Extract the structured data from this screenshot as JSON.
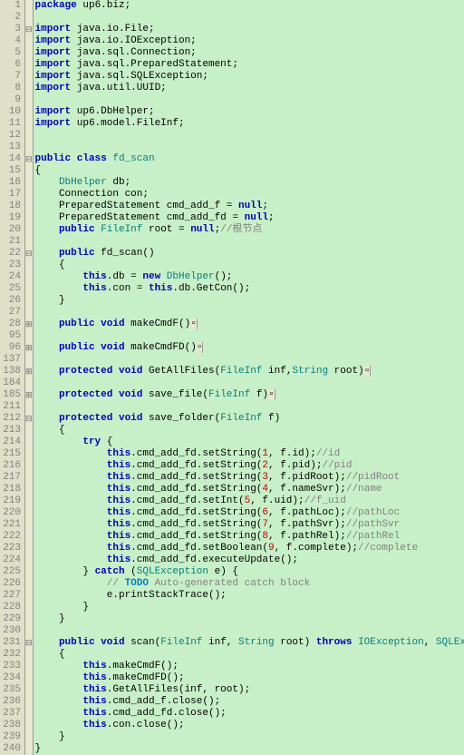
{
  "lines": [
    {
      "n": "1",
      "f": "",
      "t": [
        [
          "kw",
          "package"
        ],
        [
          "pk",
          " up6.biz;"
        ]
      ]
    },
    {
      "n": "2",
      "f": "",
      "t": []
    },
    {
      "n": "3",
      "f": "-",
      "t": [
        [
          "kw",
          "import"
        ],
        [
          "pk",
          " java.io.File;"
        ]
      ]
    },
    {
      "n": "4",
      "f": "",
      "t": [
        [
          "kw",
          "import"
        ],
        [
          "pk",
          " java.io.IOException;"
        ]
      ]
    },
    {
      "n": "5",
      "f": "",
      "t": [
        [
          "kw",
          "import"
        ],
        [
          "pk",
          " java.sql.Connection;"
        ]
      ]
    },
    {
      "n": "6",
      "f": "",
      "t": [
        [
          "kw",
          "import"
        ],
        [
          "pk",
          " java.sql.PreparedStatement;"
        ]
      ]
    },
    {
      "n": "7",
      "f": "",
      "t": [
        [
          "kw",
          "import"
        ],
        [
          "pk",
          " java.sql.SQLException;"
        ]
      ]
    },
    {
      "n": "8",
      "f": "",
      "t": [
        [
          "kw",
          "import"
        ],
        [
          "pk",
          " java.util.UUID;"
        ]
      ]
    },
    {
      "n": "9",
      "f": "",
      "t": []
    },
    {
      "n": "10",
      "f": "",
      "t": [
        [
          "kw",
          "import"
        ],
        [
          "pk",
          " up6.DbHelper;"
        ]
      ]
    },
    {
      "n": "11",
      "f": "",
      "t": [
        [
          "kw",
          "import"
        ],
        [
          "pk",
          " up6.model.FileInf;"
        ]
      ]
    },
    {
      "n": "12",
      "f": "",
      "t": []
    },
    {
      "n": "13",
      "f": "",
      "t": []
    },
    {
      "n": "14",
      "f": "-",
      "t": [
        [
          "kw",
          "public class "
        ],
        [
          "tp",
          "fd_scan"
        ]
      ]
    },
    {
      "n": "15",
      "f": "",
      "t": [
        [
          "fn",
          "{"
        ]
      ]
    },
    {
      "n": "16",
      "f": "",
      "t": [
        [
          "fn",
          "    "
        ],
        [
          "tp",
          "DbHelper"
        ],
        [
          "fn",
          " db;"
        ]
      ]
    },
    {
      "n": "17",
      "f": "",
      "t": [
        [
          "fn",
          "    Connection con;"
        ]
      ]
    },
    {
      "n": "18",
      "f": "",
      "t": [
        [
          "fn",
          "    PreparedStatement cmd_add_f = "
        ],
        [
          "kw",
          "null"
        ],
        [
          "fn",
          ";"
        ]
      ]
    },
    {
      "n": "19",
      "f": "",
      "t": [
        [
          "fn",
          "    PreparedStatement cmd_add_fd = "
        ],
        [
          "kw",
          "null"
        ],
        [
          "fn",
          ";"
        ]
      ]
    },
    {
      "n": "20",
      "f": "",
      "t": [
        [
          "fn",
          "    "
        ],
        [
          "kw",
          "public "
        ],
        [
          "tp",
          "FileInf"
        ],
        [
          "fn",
          " root = "
        ],
        [
          "kw",
          "null"
        ],
        [
          "fn",
          ";"
        ],
        [
          "cmt",
          "//根节点"
        ]
      ]
    },
    {
      "n": "21",
      "f": "",
      "t": []
    },
    {
      "n": "22",
      "f": "-",
      "t": [
        [
          "fn",
          "    "
        ],
        [
          "kw",
          "public"
        ],
        [
          "fn",
          " fd_scan()"
        ]
      ]
    },
    {
      "n": "23",
      "f": "",
      "t": [
        [
          "fn",
          "    {"
        ]
      ]
    },
    {
      "n": "24",
      "f": "",
      "t": [
        [
          "fn",
          "        "
        ],
        [
          "kw",
          "this"
        ],
        [
          "fn",
          ".db = "
        ],
        [
          "kw",
          "new "
        ],
        [
          "tp",
          "DbHelper"
        ],
        [
          "fn",
          "();"
        ]
      ]
    },
    {
      "n": "25",
      "f": "",
      "t": [
        [
          "fn",
          "        "
        ],
        [
          "kw",
          "this"
        ],
        [
          "fn",
          ".con = "
        ],
        [
          "kw",
          "this"
        ],
        [
          "fn",
          ".db.GetCon();"
        ]
      ]
    },
    {
      "n": "26",
      "f": "",
      "t": [
        [
          "fn",
          "    }"
        ]
      ]
    },
    {
      "n": "27",
      "f": "",
      "t": []
    },
    {
      "n": "28",
      "f": "+",
      "t": [
        [
          "fn",
          "    "
        ],
        [
          "kw",
          "public void"
        ],
        [
          "fn",
          " makeCmdF()"
        ],
        [
          "fold",
          "▫"
        ]
      ]
    },
    {
      "n": "95",
      "f": "",
      "t": []
    },
    {
      "n": "96",
      "f": "+",
      "t": [
        [
          "fn",
          "    "
        ],
        [
          "kw",
          "public void"
        ],
        [
          "fn",
          " makeCmdFD()"
        ],
        [
          "fold",
          "▫"
        ]
      ]
    },
    {
      "n": "137",
      "f": "",
      "t": []
    },
    {
      "n": "138",
      "f": "+",
      "t": [
        [
          "fn",
          "    "
        ],
        [
          "kw",
          "protected void"
        ],
        [
          "fn",
          " GetAllFiles("
        ],
        [
          "tp",
          "FileInf"
        ],
        [
          "fn",
          " inf,"
        ],
        [
          "tp",
          "String"
        ],
        [
          "fn",
          " root)"
        ],
        [
          "fold",
          "▫"
        ]
      ]
    },
    {
      "n": "184",
      "f": "",
      "t": []
    },
    {
      "n": "185",
      "f": "+",
      "t": [
        [
          "fn",
          "    "
        ],
        [
          "kw",
          "protected void"
        ],
        [
          "fn",
          " save_file("
        ],
        [
          "tp",
          "FileInf"
        ],
        [
          "fn",
          " f)"
        ],
        [
          "fold",
          "▫"
        ]
      ]
    },
    {
      "n": "211",
      "f": "",
      "t": []
    },
    {
      "n": "212",
      "f": "-",
      "t": [
        [
          "fn",
          "    "
        ],
        [
          "kw",
          "protected void"
        ],
        [
          "fn",
          " save_folder("
        ],
        [
          "tp",
          "FileInf"
        ],
        [
          "fn",
          " f)"
        ]
      ]
    },
    {
      "n": "213",
      "f": "",
      "t": [
        [
          "fn",
          "    {"
        ]
      ]
    },
    {
      "n": "214",
      "f": "",
      "t": [
        [
          "fn",
          "        "
        ],
        [
          "kw",
          "try"
        ],
        [
          "fn",
          " {"
        ]
      ]
    },
    {
      "n": "215",
      "f": "",
      "t": [
        [
          "fn",
          "            "
        ],
        [
          "kw",
          "this"
        ],
        [
          "fn",
          ".cmd_add_fd.setString("
        ],
        [
          "num",
          "1"
        ],
        [
          "fn",
          ", f.id);"
        ],
        [
          "cmt",
          "//id"
        ]
      ]
    },
    {
      "n": "216",
      "f": "",
      "t": [
        [
          "fn",
          "            "
        ],
        [
          "kw",
          "this"
        ],
        [
          "fn",
          ".cmd_add_fd.setString("
        ],
        [
          "num",
          "2"
        ],
        [
          "fn",
          ", f.pid);"
        ],
        [
          "cmt",
          "//pid"
        ]
      ]
    },
    {
      "n": "217",
      "f": "",
      "t": [
        [
          "fn",
          "            "
        ],
        [
          "kw",
          "this"
        ],
        [
          "fn",
          ".cmd_add_fd.setString("
        ],
        [
          "num",
          "3"
        ],
        [
          "fn",
          ", f.pidRoot);"
        ],
        [
          "cmt",
          "//pidRoot"
        ]
      ]
    },
    {
      "n": "218",
      "f": "",
      "t": [
        [
          "fn",
          "            "
        ],
        [
          "kw",
          "this"
        ],
        [
          "fn",
          ".cmd_add_fd.setString("
        ],
        [
          "num",
          "4"
        ],
        [
          "fn",
          ", f.nameSvr);"
        ],
        [
          "cmt",
          "//name"
        ]
      ]
    },
    {
      "n": "219",
      "f": "",
      "t": [
        [
          "fn",
          "            "
        ],
        [
          "kw",
          "this"
        ],
        [
          "fn",
          ".cmd_add_fd.setInt("
        ],
        [
          "num",
          "5"
        ],
        [
          "fn",
          ", f.uid);"
        ],
        [
          "cmt",
          "//f_uid"
        ]
      ]
    },
    {
      "n": "220",
      "f": "",
      "t": [
        [
          "fn",
          "            "
        ],
        [
          "kw",
          "this"
        ],
        [
          "fn",
          ".cmd_add_fd.setString("
        ],
        [
          "num",
          "6"
        ],
        [
          "fn",
          ", f.pathLoc);"
        ],
        [
          "cmt",
          "//pathLoc"
        ]
      ]
    },
    {
      "n": "221",
      "f": "",
      "t": [
        [
          "fn",
          "            "
        ],
        [
          "kw",
          "this"
        ],
        [
          "fn",
          ".cmd_add_fd.setString("
        ],
        [
          "num",
          "7"
        ],
        [
          "fn",
          ", f.pathSvr);"
        ],
        [
          "cmt",
          "//pathSvr"
        ]
      ]
    },
    {
      "n": "222",
      "f": "",
      "t": [
        [
          "fn",
          "            "
        ],
        [
          "kw",
          "this"
        ],
        [
          "fn",
          ".cmd_add_fd.setString("
        ],
        [
          "num",
          "8"
        ],
        [
          "fn",
          ", f.pathRel);"
        ],
        [
          "cmt",
          "//pathRel"
        ]
      ]
    },
    {
      "n": "223",
      "f": "",
      "t": [
        [
          "fn",
          "            "
        ],
        [
          "kw",
          "this"
        ],
        [
          "fn",
          ".cmd_add_fd.setBoolean("
        ],
        [
          "num",
          "9"
        ],
        [
          "fn",
          ", f.complete);"
        ],
        [
          "cmt",
          "//complete"
        ]
      ]
    },
    {
      "n": "224",
      "f": "",
      "t": [
        [
          "fn",
          "            "
        ],
        [
          "kw",
          "this"
        ],
        [
          "fn",
          ".cmd_add_fd.executeUpdate();"
        ]
      ]
    },
    {
      "n": "225",
      "f": "",
      "t": [
        [
          "fn",
          "        } "
        ],
        [
          "kw",
          "catch"
        ],
        [
          "fn",
          " ("
        ],
        [
          "tp",
          "SQLException"
        ],
        [
          "fn",
          " e) {"
        ]
      ]
    },
    {
      "n": "226",
      "f": "",
      "t": [
        [
          "fn",
          "            "
        ],
        [
          "cmt",
          "// "
        ],
        [
          "todo",
          "TODO"
        ],
        [
          "cmt",
          " Auto-generated catch block"
        ]
      ]
    },
    {
      "n": "227",
      "f": "",
      "t": [
        [
          "fn",
          "            e.printStackTrace();"
        ]
      ]
    },
    {
      "n": "228",
      "f": "",
      "t": [
        [
          "fn",
          "        }"
        ]
      ]
    },
    {
      "n": "229",
      "f": "",
      "t": [
        [
          "fn",
          "    }"
        ]
      ]
    },
    {
      "n": "230",
      "f": "",
      "t": []
    },
    {
      "n": "231",
      "f": "-",
      "t": [
        [
          "fn",
          "    "
        ],
        [
          "kw",
          "public void"
        ],
        [
          "fn",
          " scan("
        ],
        [
          "tp",
          "FileInf"
        ],
        [
          "fn",
          " inf, "
        ],
        [
          "tp",
          "String"
        ],
        [
          "fn",
          " root) "
        ],
        [
          "kw",
          "throws "
        ],
        [
          "tp",
          "IOException"
        ],
        [
          "fn",
          ", "
        ],
        [
          "tp",
          "SQLException"
        ]
      ]
    },
    {
      "n": "232",
      "f": "",
      "t": [
        [
          "fn",
          "    {"
        ]
      ]
    },
    {
      "n": "233",
      "f": "",
      "t": [
        [
          "fn",
          "        "
        ],
        [
          "kw",
          "this"
        ],
        [
          "fn",
          ".makeCmdF();"
        ]
      ]
    },
    {
      "n": "234",
      "f": "",
      "t": [
        [
          "fn",
          "        "
        ],
        [
          "kw",
          "this"
        ],
        [
          "fn",
          ".makeCmdFD();"
        ]
      ]
    },
    {
      "n": "235",
      "f": "",
      "t": [
        [
          "fn",
          "        "
        ],
        [
          "kw",
          "this"
        ],
        [
          "fn",
          ".GetAllFiles(inf, root);"
        ]
      ]
    },
    {
      "n": "236",
      "f": "",
      "t": [
        [
          "fn",
          "        "
        ],
        [
          "kw",
          "this"
        ],
        [
          "fn",
          ".cmd_add_f.close();"
        ]
      ]
    },
    {
      "n": "237",
      "f": "",
      "t": [
        [
          "fn",
          "        "
        ],
        [
          "kw",
          "this"
        ],
        [
          "fn",
          ".cmd_add_fd.close();"
        ]
      ]
    },
    {
      "n": "238",
      "f": "",
      "t": [
        [
          "fn",
          "        "
        ],
        [
          "kw",
          "this"
        ],
        [
          "fn",
          ".con.close();"
        ]
      ]
    },
    {
      "n": "239",
      "f": "",
      "t": [
        [
          "fn",
          "    }"
        ]
      ]
    },
    {
      "n": "240",
      "f": "",
      "t": [
        [
          "fn",
          "}"
        ]
      ]
    }
  ]
}
